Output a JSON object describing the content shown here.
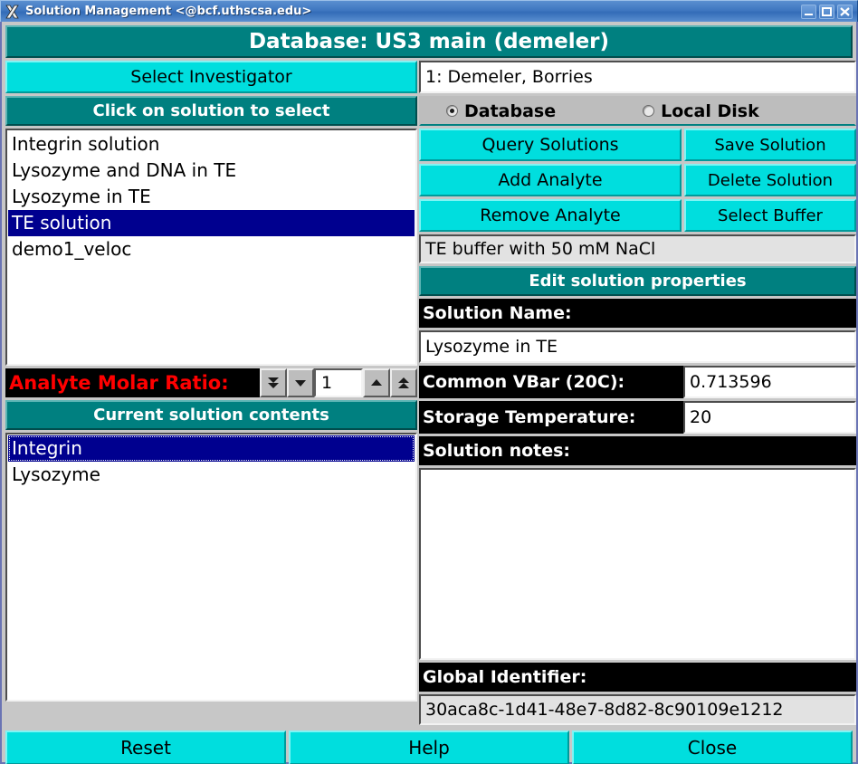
{
  "window": {
    "title": "Solution Management <@bcf.uthscsa.edu>",
    "icon": "x11-logo-icon",
    "controls": {
      "minimize": "minimize-icon",
      "maximize": "maximize-icon",
      "close": "close-icon"
    }
  },
  "banner": {
    "text": "Database: US3 main (demeler)"
  },
  "investigator": {
    "button_label": "Select Investigator",
    "value": "1: Demeler, Borries"
  },
  "solution_list_header": {
    "label": "Click on solution to select"
  },
  "source": {
    "options": [
      {
        "label": "Database",
        "selected": true
      },
      {
        "label": "Local Disk",
        "selected": false
      }
    ]
  },
  "solutions": {
    "items": [
      {
        "label": "Integrin solution",
        "selected": false
      },
      {
        "label": "Lysozyme and DNA in TE",
        "selected": false
      },
      {
        "label": "Lysozyme in TE",
        "selected": false
      },
      {
        "label": "TE solution",
        "selected": true
      },
      {
        "label": "demo1_veloc",
        "selected": false
      }
    ]
  },
  "actions": {
    "query_solutions": "Query Solutions",
    "save_solution": "Save Solution",
    "add_analyte": "Add Analyte",
    "delete_solution": "Delete Solution",
    "remove_analyte": "Remove Analyte",
    "select_buffer": "Select Buffer"
  },
  "buffer": {
    "value": "TE buffer with 50 mM NaCl"
  },
  "edit_properties": {
    "header": "Edit solution properties",
    "solution_name_label": "Solution Name:",
    "solution_name_value": "Lysozyme in TE",
    "vbar_label": "Common VBar (20C):",
    "vbar_value": "0.713596",
    "storage_temp_label": "Storage Temperature:",
    "storage_temp_value": "20",
    "notes_label": "Solution notes:",
    "notes_value": "",
    "global_id_label": "Global Identifier:",
    "global_id_value": "30aca8c-1d41-48e7-8d82-8c90109e1212"
  },
  "molar_ratio": {
    "label": "Analyte Molar Ratio:",
    "value": "1",
    "buttons": {
      "double_down": "double-chevron-down-icon",
      "down": "chevron-down-icon",
      "up": "chevron-up-icon",
      "double_up": "double-chevron-up-icon"
    }
  },
  "contents": {
    "header": "Current solution contents",
    "items": [
      {
        "label": "Integrin",
        "selected": true
      },
      {
        "label": "Lysozyme",
        "selected": false
      }
    ]
  },
  "footer": {
    "reset": "Reset",
    "help": "Help",
    "close": "Close"
  },
  "colors": {
    "teal": "#008080",
    "cyan": "#00dede",
    "selection": "#00008f",
    "accent_red": "#ff0000",
    "titlebar": "#3f77c0"
  }
}
